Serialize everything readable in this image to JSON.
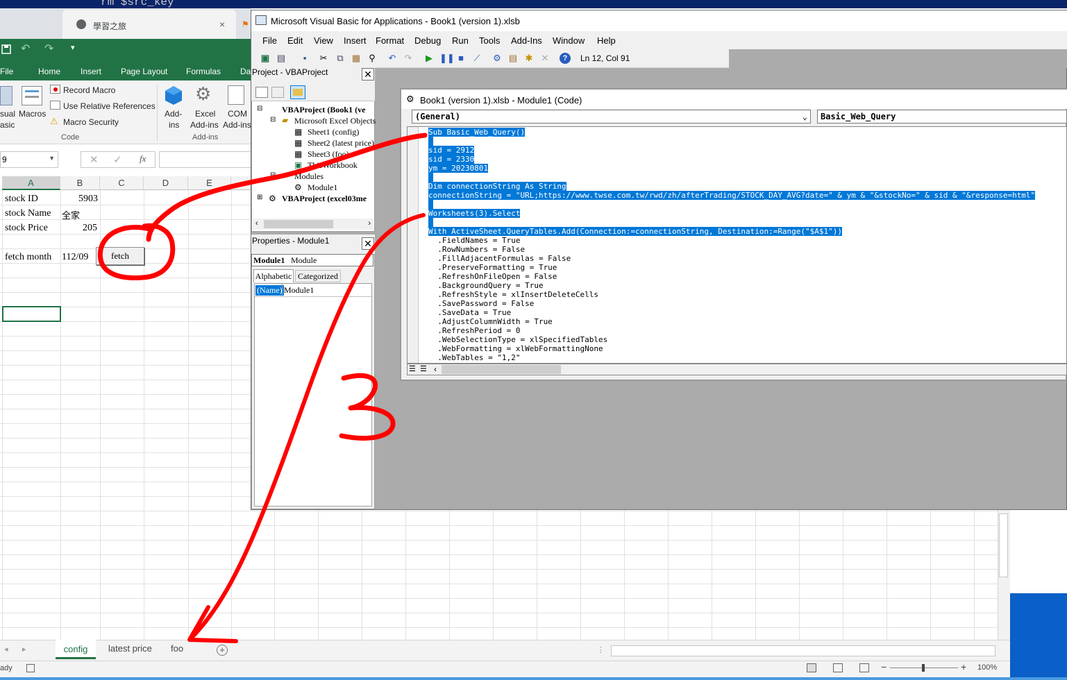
{
  "desktop": {
    "top_text": "rm $src_key"
  },
  "browser": {
    "tab_title": "學習之旅",
    "tab_close": "×"
  },
  "excel": {
    "ribbon_tabs": [
      "File",
      "Home",
      "Insert",
      "Page Layout",
      "Formulas",
      "Da"
    ],
    "code_group": {
      "visual_basic": [
        "sual",
        "asic"
      ],
      "macros": "Macros",
      "record_macro": "Record Macro",
      "use_relative": "Use Relative References",
      "macro_security": "Macro Security",
      "group_label": "Code"
    },
    "addins_group": {
      "addins": [
        "Add-",
        "ins"
      ],
      "excel_addins": [
        "Excel",
        "Add-ins"
      ],
      "com_addins": [
        "COM",
        "Add-ins"
      ],
      "group_label": "Add-ins"
    },
    "name_box": "9",
    "columns": [
      "A",
      "B",
      "C",
      "D",
      "E"
    ],
    "cells": {
      "a1": "stock ID",
      "b1": "5903",
      "a2": "stock Name",
      "b2": "全家",
      "a3": "stock Price",
      "b3": "205",
      "a5": "fetch month",
      "b5": "112/09"
    },
    "fetch_button": "fetch",
    "sheets": [
      "config",
      "latest price",
      "foo"
    ],
    "status_text": "ady",
    "zoom": "100%"
  },
  "vbe": {
    "title": "Microsoft Visual Basic for Applications - Book1 (version 1).xlsb",
    "menus": [
      "File",
      "Edit",
      "View",
      "Insert",
      "Format",
      "Debug",
      "Run",
      "Tools",
      "Add-Ins",
      "Window",
      "Help"
    ],
    "position": "Ln 12, Col 91",
    "project_panel": {
      "title": "Project - VBAProject",
      "tree": [
        "VBAProject (Book1 (ve",
        "Microsoft Excel Objects",
        "Sheet1 (config)",
        "Sheet2 (latest price)",
        "Sheet3 (foo)",
        "ThisWorkbook",
        "Modules",
        "Module1",
        "VBAProject (excel03me"
      ]
    },
    "properties_panel": {
      "title": "Properties - Module1",
      "object_name": "Module1",
      "object_type": "Module",
      "tab_alpha": "Alphabetic",
      "tab_cat": "Categorized",
      "prop_name": "(Name)",
      "prop_value": "Module1"
    },
    "code_window": {
      "title": "Book1 (version 1).xlsb - Module1 (Code)",
      "object_combo": "(General)",
      "proc_combo": "Basic_Web_Query",
      "lines": [
        "Sub Basic_Web_Query()",
        " ",
        "sid = 2912",
        "sid = 2330",
        "ym = 20230801",
        " ",
        "Dim connectionString As String",
        "connectionString = \"URL;https://www.twse.com.tw/rwd/zh/afterTrading/STOCK_DAY_AVG?date=\" & ym & \"&stockNo=\" & sid & \"&response=html\"",
        " ",
        "Worksheets(3).Select",
        " ",
        "With ActiveSheet.QueryTables.Add(Connection:=connectionString, Destination:=Range(\"$A$1\"))",
        "  .FieldNames = True",
        "  .RowNumbers = False",
        "  .FillAdjacentFormulas = False",
        "  .PreserveFormatting = True",
        "  .RefreshOnFileOpen = False",
        "  .BackgroundQuery = True",
        "  .RefreshStyle = xlInsertDeleteCells",
        "  .SavePassword = False",
        "  .SaveData = True",
        "  .AdjustColumnWidth = True",
        "  .RefreshPeriod = 0",
        "  .WebSelectionType = xlSpecifiedTables",
        "  .WebFormatting = xlWebFormattingNone",
        "  .WebTables = \"1,2\""
      ]
    }
  },
  "annotation": {
    "label": "3",
    "color": "#ff0000"
  }
}
